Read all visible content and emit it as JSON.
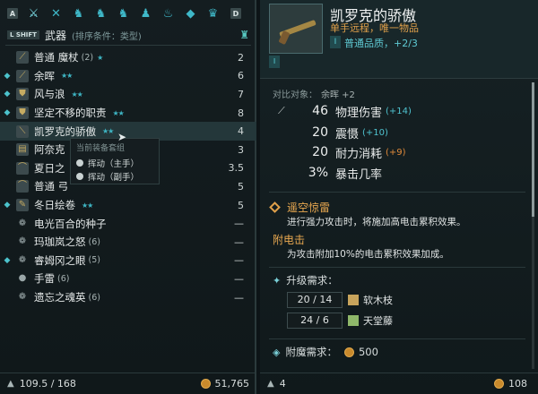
{
  "inventory": {
    "key_left": "A",
    "key_right": "D",
    "shift_key": "L SHIFT",
    "category": "武器",
    "sort_label": "(排序条件：类型)",
    "tabs": [
      "sword-icon",
      "crossed-swords-icon",
      "armor-icon",
      "armor-icon",
      "armor-icon",
      "boots-icon",
      "lamp-icon",
      "gem-icon",
      "crown-icon"
    ],
    "items": [
      {
        "name": "普通 魔杖",
        "count": "(2)",
        "stars": "★",
        "value": "2",
        "mark": "",
        "icon": "staff-icon"
      },
      {
        "name": "余晖",
        "count": "",
        "stars": "★★",
        "value": "6",
        "mark": "◆",
        "icon": "sword-icon"
      },
      {
        "name": "风与浪",
        "count": "",
        "stars": "★★",
        "value": "7",
        "mark": "◆",
        "icon": "shield-icon"
      },
      {
        "name": "坚定不移的职责",
        "count": "",
        "stars": "★★",
        "value": "8",
        "mark": "◆",
        "icon": "shield-icon"
      },
      {
        "name": "凯罗克的骄傲",
        "count": "",
        "stars": "★★",
        "value": "4",
        "mark": "",
        "icon": "pistol-icon"
      },
      {
        "name": "阿奈克",
        "count": "",
        "stars": "",
        "value": "3",
        "mark": "",
        "icon": "book-icon"
      },
      {
        "name": "夏日之",
        "count": "",
        "stars": "",
        "value": "3.5",
        "mark": "",
        "icon": "bow-icon"
      },
      {
        "name": "普通 弓",
        "count": "",
        "stars": "",
        "value": "5",
        "mark": "",
        "icon": "bow-icon"
      },
      {
        "name": "冬日绘卷",
        "count": "",
        "stars": "★★",
        "value": "5",
        "mark": "◆",
        "icon": "scroll-icon"
      },
      {
        "name": "电光百合的种子",
        "count": "",
        "stars": "",
        "value": "—",
        "mark": "",
        "icon": "seed-icon"
      },
      {
        "name": "玛珈岚之怒",
        "count": "(6)",
        "stars": "",
        "value": "—",
        "mark": "",
        "icon": "seed-icon"
      },
      {
        "name": "睿姆冈之眼",
        "count": "(5)",
        "stars": "",
        "value": "—",
        "mark": "◆",
        "icon": "seed-icon"
      },
      {
        "name": "手雷",
        "count": "(6)",
        "stars": "",
        "value": "—",
        "mark": "",
        "icon": "grenade-icon"
      },
      {
        "name": "遗忘之魂英",
        "count": "(6)",
        "stars": "",
        "value": "—",
        "mark": "",
        "icon": "seed-icon"
      }
    ],
    "tooltip": {
      "header": "当前装备套组",
      "options": [
        "挥动（主手）",
        "挥动（副手）"
      ]
    },
    "weight": "109.5 / 168",
    "money": "51,765"
  },
  "detail": {
    "title": "凯罗克的骄傲",
    "subtitle": "单手远程，唯一物品",
    "rarity_badge": "I",
    "rarity": "普通品质，+2/3",
    "upgrade_badge": "I",
    "compare_label": "对比对象：",
    "compare_item": "余晖 +2",
    "stats": [
      {
        "icon": "sword-icon",
        "value": "46",
        "name": "物理伤害",
        "bonus": "(+14)",
        "bonus_color": "#4fc3d0"
      },
      {
        "icon": "",
        "value": "20",
        "name": "震慑",
        "bonus": "(+10)",
        "bonus_color": "#4fc3d0"
      },
      {
        "icon": "",
        "value": "20",
        "name": "耐力消耗",
        "bonus": "(+9)",
        "bonus_color": "#e08a3a"
      },
      {
        "icon": "",
        "value": "3%",
        "name": "暴击几率",
        "bonus": "",
        "bonus_color": "#4fc3d0"
      }
    ],
    "ability_name": "遥空惊雷",
    "ability_desc": "进行强力攻击时，将施加高电击累积效果。",
    "effect_name": "附电击",
    "effect_desc": "为攻击附加10%的电击累积效果加成。",
    "upgrade_label": "升级需求：",
    "requirements": [
      {
        "amount": "20 / 14",
        "material": "软木枝",
        "color": "#c8a45c"
      },
      {
        "amount": "24 / 6",
        "material": "天堂藤",
        "color": "#8fb86a"
      }
    ],
    "enchant_label": "附魔需求：",
    "enchant_cost": "500",
    "weight": "4",
    "money": "108"
  }
}
